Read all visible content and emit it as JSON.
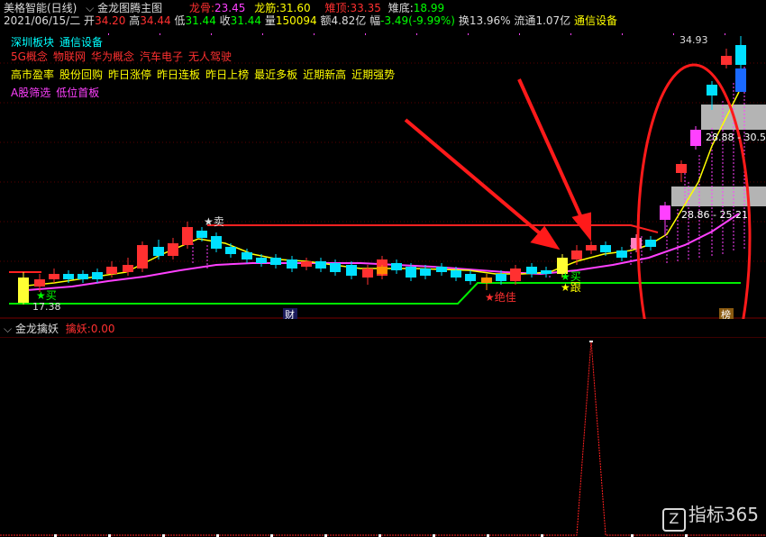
{
  "header": {
    "stock_title": "美格智能(日线)",
    "indicator_name": "金龙图腾主图",
    "dragon_head_label": "龙骨:",
    "dragon_head_value": "23.45",
    "dragon_tendon_label": "龙筋:",
    "dragon_tendon_value": "31.60",
    "dragon_top_label": "雉顶:",
    "dragon_top_value": "33.35",
    "dragon_bottom_label": "雉底:",
    "dragon_bottom_value": "18.99",
    "date": "2021/06/15/二",
    "open_label": "开",
    "open_value": "34.20",
    "high_label": "高",
    "high_value": "34.44",
    "low_label": "低",
    "low_value": "31.44",
    "close_label": "收",
    "close_value": "31.44",
    "volume_label": "量",
    "volume_value": "150094",
    "amount_label": "额",
    "amount_value": "4.82亿",
    "change_label": "幅",
    "change_value": "-3.49(-9.99%)",
    "turnover_label": "换",
    "turnover_value": "13.96%",
    "float_label": "流通",
    "float_value": "1.07亿",
    "sector": "通信设备"
  },
  "tags": {
    "line1": [
      "深圳板块",
      "通信设备"
    ],
    "line2": [
      "5G概念",
      "物联网",
      "华为概念",
      "汽车电子",
      "无人驾驶"
    ],
    "line3": [
      "高市盈率",
      "股份回购",
      "昨日涨停",
      "昨日连板",
      "昨日上榜",
      "最近多板",
      "近期新高",
      "近期强势"
    ],
    "line4": [
      "A股筛选",
      "低位首板"
    ]
  },
  "chart_labels": {
    "sell": "★卖",
    "buy1": "★买",
    "buy2": "★买",
    "follow": "★跟",
    "best": "★绝佳",
    "low_price": "17.38",
    "caibao": "财",
    "bang": "榜",
    "range1": "28.86 - 25.21",
    "range2": "28.88 - 30.5",
    "top_price": "34.93"
  },
  "sub_chart": {
    "title": "金龙擒妖",
    "value_label": "擒妖:",
    "value": "0.00"
  },
  "watermark": {
    "logo": "Z",
    "text": "指标365"
  },
  "colors": {
    "up": "#ff3030",
    "down": "#00e0ff",
    "ma_yellow": "#ffff00",
    "ma_magenta": "#ff40ff",
    "support_green": "#00ff00",
    "annotation_red": "#ff0000"
  }
}
